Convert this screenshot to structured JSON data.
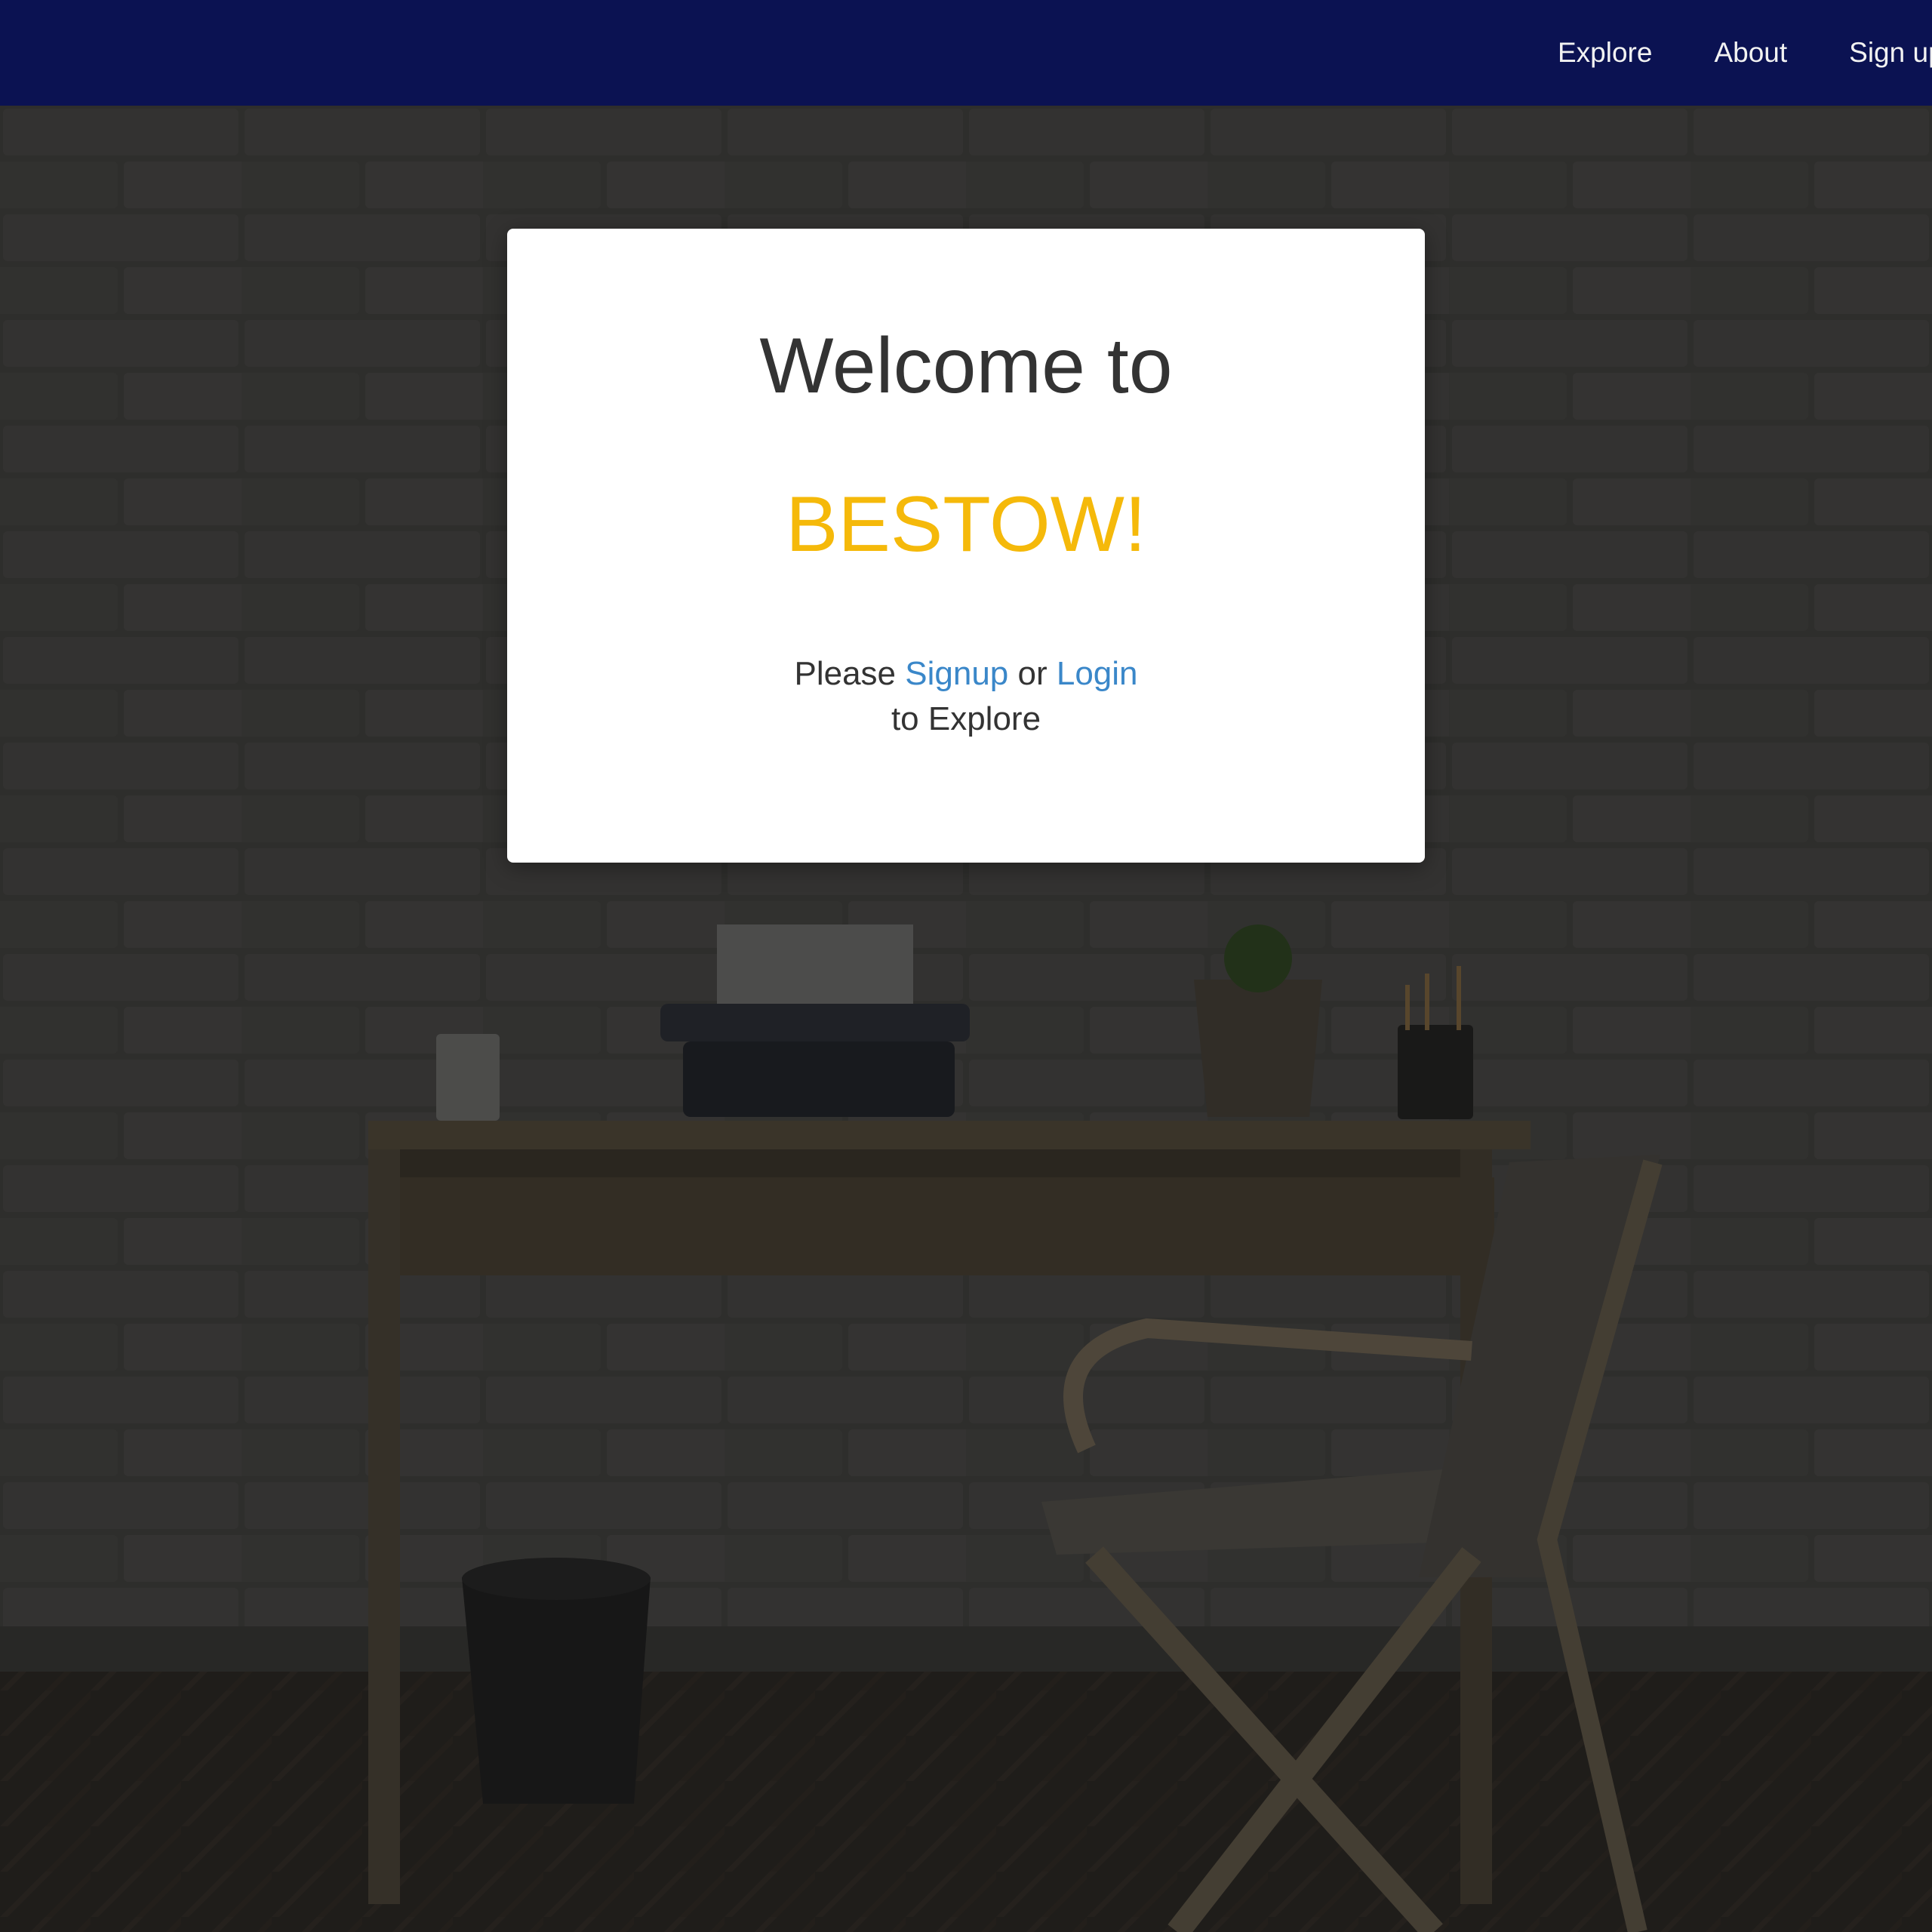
{
  "navbar": {
    "links": [
      {
        "label": "Explore"
      },
      {
        "label": "About"
      },
      {
        "label": "Sign up"
      }
    ],
    "background_color": "#0b1252"
  },
  "modal": {
    "welcome_text": "Welcome to",
    "brand_text": "BESTOW!",
    "prompt_before": "Please",
    "signup_link": "Signup",
    "prompt_middle": "or",
    "login_link": "Login",
    "prompt_after": "to Explore",
    "brand_color": "#f5b90a",
    "link_color": "#3a87c9"
  }
}
